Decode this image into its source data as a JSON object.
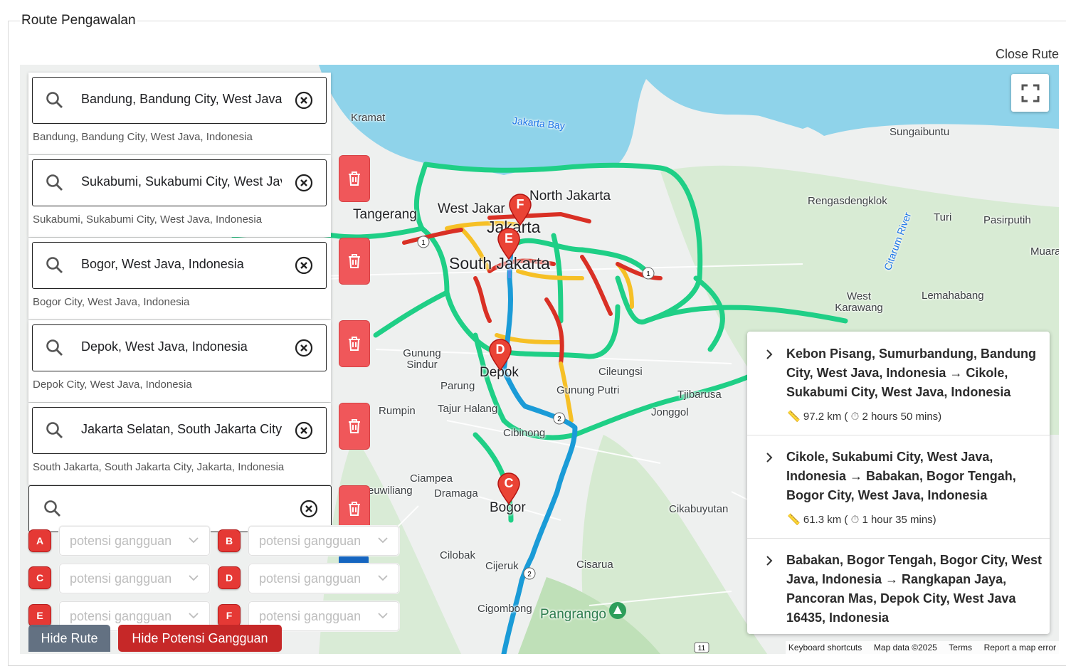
{
  "panel": {
    "title": "Route Pengawalan",
    "close_label": "Close Rute"
  },
  "map": {
    "places": [
      {
        "id": "kramat",
        "name": "Kramat"
      },
      {
        "id": "jakarta_bay",
        "name": "Jakarta Bay"
      },
      {
        "id": "sungaibuntu",
        "name": "Sungaibuntu"
      },
      {
        "id": "north_jakarta",
        "name": "North Jakarta"
      },
      {
        "id": "tangerang",
        "name": "Tangerang"
      },
      {
        "id": "west_jakarta",
        "name": "West Jakar"
      },
      {
        "id": "jakarta",
        "name": "Jakarta"
      },
      {
        "id": "south_jakarta",
        "name": "South Jakarta"
      },
      {
        "id": "rengasdengklok",
        "name": "Rengasdengklok"
      },
      {
        "id": "turi",
        "name": "Turi"
      },
      {
        "id": "pasirputih",
        "name": "Pasirputih"
      },
      {
        "id": "citarum",
        "name": "Citarum River"
      },
      {
        "id": "muara",
        "name": "Muara"
      },
      {
        "id": "west_karawang",
        "name": "West Karawang"
      },
      {
        "id": "lemahabang",
        "name": "Lemahabang"
      },
      {
        "id": "gunung_sindur",
        "name": "Gunung Sindur"
      },
      {
        "id": "depok",
        "name": "Depok"
      },
      {
        "id": "parung",
        "name": "Parung"
      },
      {
        "id": "cileungsi",
        "name": "Cileungsi"
      },
      {
        "id": "gunung_putri",
        "name": "Gunung Putri"
      },
      {
        "id": "tjibarusa",
        "name": "Tjibarusa"
      },
      {
        "id": "jonggol",
        "name": "Jonggol"
      },
      {
        "id": "rumpin",
        "name": "Rumpin"
      },
      {
        "id": "tajur_halang",
        "name": "Tajur Halang"
      },
      {
        "id": "cibinong",
        "name": "Cibinong"
      },
      {
        "id": "ciampea",
        "name": "Ciampea"
      },
      {
        "id": "leuwiliang",
        "name": "euwiliang"
      },
      {
        "id": "dramaga",
        "name": "Dramaga"
      },
      {
        "id": "bogor",
        "name": "Bogor"
      },
      {
        "id": "cikabuyutan",
        "name": "Cikabuyutan"
      },
      {
        "id": "cilobak",
        "name": "Cilobak"
      },
      {
        "id": "cijeruk",
        "name": "Cijeruk"
      },
      {
        "id": "cisarua",
        "name": "Cisarua"
      },
      {
        "id": "cigombong",
        "name": "Cigombong"
      },
      {
        "id": "pangrango",
        "name": "Pangrango"
      }
    ],
    "markers": [
      "F",
      "E",
      "D",
      "C"
    ],
    "attribution": {
      "shortcuts": "Keyboard shortcuts",
      "data": "Map data ©2025",
      "terms": "Terms",
      "report": "Report a map error"
    }
  },
  "waypoints": [
    {
      "value": "Bandung, Bandung City, West Java",
      "sub": "Bandung, Bandung City, West Java, Indonesia"
    },
    {
      "value": "Sukabumi, Sukabumi City, West Java",
      "sub": "Sukabumi, Sukabumi City, West Java, Indonesia"
    },
    {
      "value": "Bogor, West Java, Indonesia",
      "sub": "Bogor City, West Java, Indonesia"
    },
    {
      "value": "Depok, West Java, Indonesia",
      "sub": "Depok City, West Java, Indonesia"
    },
    {
      "value": "Jakarta Selatan, South Jakarta City",
      "sub": "South Jakarta, South Jakarta City, Jakarta, Indonesia"
    }
  ],
  "gangguan": {
    "placeholder": "potensi gangguan",
    "labels": [
      "A",
      "B",
      "C",
      "D",
      "E",
      "F"
    ]
  },
  "buttons": {
    "hide_rute": "Hide Rute",
    "hide_gangguan": "Hide Potensi Gangguan"
  },
  "routes": [
    {
      "title": "Kebon Pisang, Sumurbandung, Bandung City, West Java, Indonesia → Cikole, Sukabumi City, West Java, Indonesia",
      "distance": "97.2 km (",
      "duration": "2 hours 50 mins)"
    },
    {
      "title": "Cikole, Sukabumi City, West Java, Indonesia → Babakan, Bogor Tengah, Bogor City, West Java, Indonesia",
      "distance": "61.3 km (",
      "duration": "1 hour 35 mins)"
    },
    {
      "title": "Babakan, Bogor Tengah, Bogor City, West Java, Indonesia → Rangkapan Jaya, Pancoran Mas, Depok City, West Java 16435, Indonesia",
      "distance": "",
      "duration": ""
    }
  ],
  "colors": {
    "traffic_green": "#1fcf86",
    "traffic_yellow": "#f6c026",
    "traffic_red": "#d93025",
    "route_blue": "#1a9bd7",
    "marker_red": "#ea4335",
    "water": "#8fd3ea"
  }
}
